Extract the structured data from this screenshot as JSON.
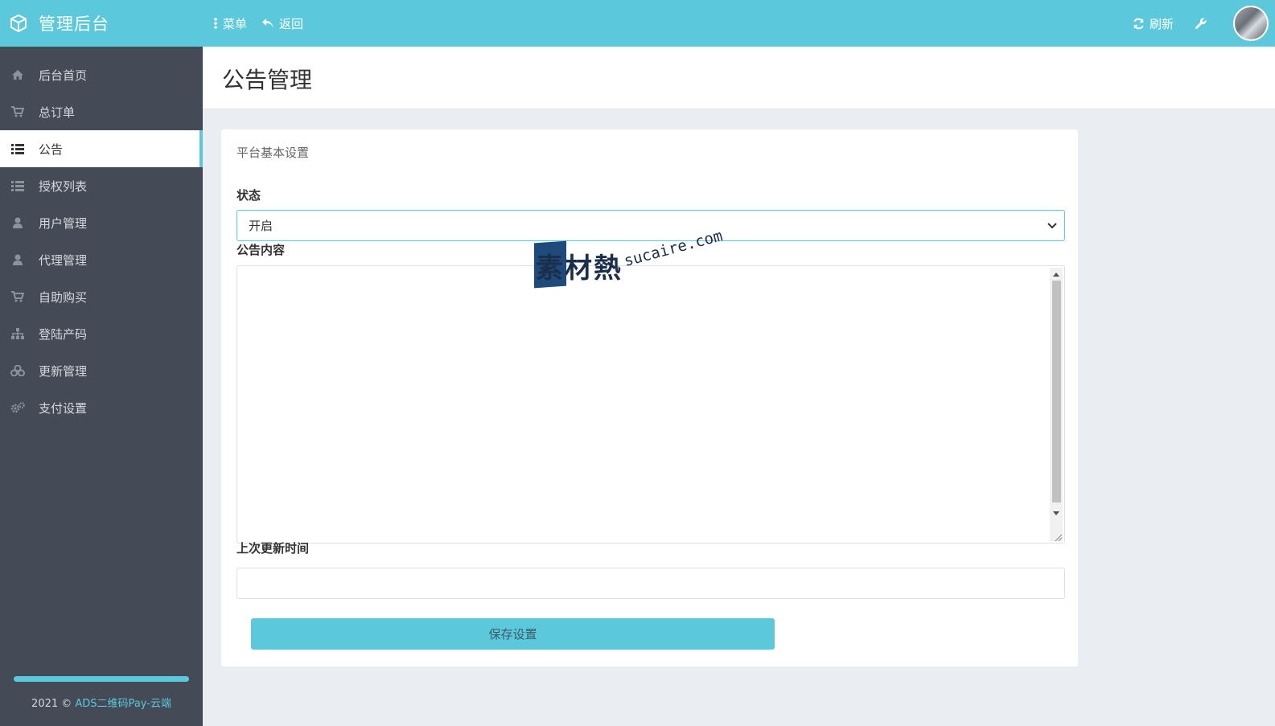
{
  "header": {
    "brand_title": "管理后台",
    "menu_label": "菜单",
    "back_label": "返回",
    "refresh_label": "刷新",
    "accent_color": "#5bc8dc"
  },
  "sidebar": {
    "items": [
      {
        "label": "后台首页",
        "icon": "home-icon",
        "active": false
      },
      {
        "label": "总订单",
        "icon": "cart-icon",
        "active": false
      },
      {
        "label": "公告",
        "icon": "list-icon",
        "active": true
      },
      {
        "label": "授权列表",
        "icon": "list-icon",
        "active": false
      },
      {
        "label": "用户管理",
        "icon": "user-icon",
        "active": false
      },
      {
        "label": "代理管理",
        "icon": "user-icon",
        "active": false
      },
      {
        "label": "自助购买",
        "icon": "cart-icon",
        "active": false
      },
      {
        "label": "登陆产码",
        "icon": "sitemap-icon",
        "active": false
      },
      {
        "label": "更新管理",
        "icon": "cubes-icon",
        "active": false
      },
      {
        "label": "支付设置",
        "icon": "cogs-icon",
        "active": false
      }
    ],
    "footer_prefix": "2021 © ",
    "footer_brand": "ADS二维码Pay-云端"
  },
  "page": {
    "title": "公告管理"
  },
  "form": {
    "card_title": "平台基本设置",
    "status_label": "状态",
    "status_value": "开启",
    "content_label": "公告内容",
    "content_value": "",
    "last_update_label": "上次更新时间",
    "last_update_value": "",
    "save_label": "保存设置"
  },
  "watermark": {
    "cn": "素材熱",
    "en": "sucaire.com"
  }
}
